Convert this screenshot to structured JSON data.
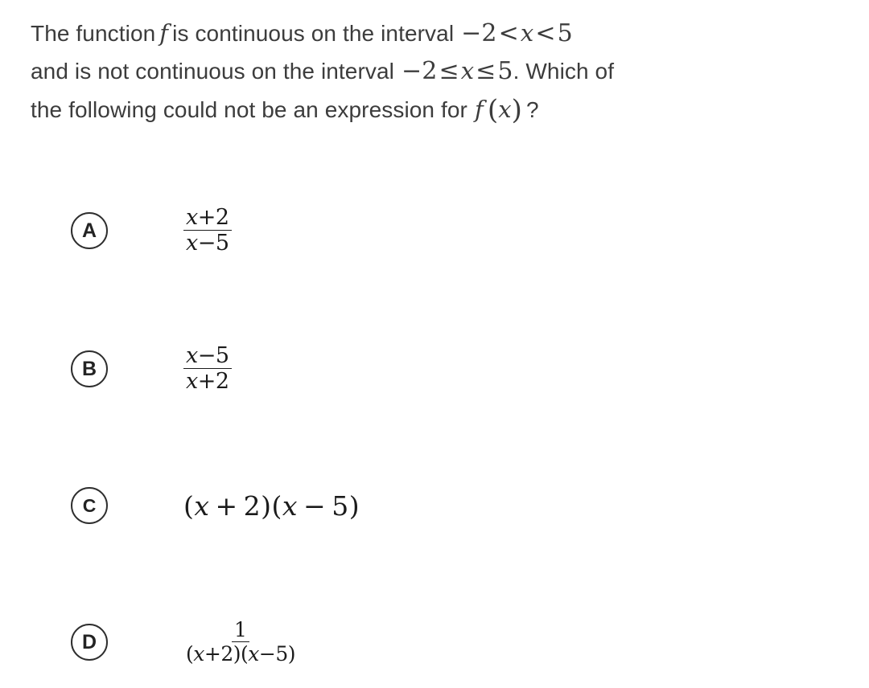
{
  "theme": {
    "background": "#ffffff",
    "text_color": "#3c3c3c",
    "math_color": "#1b1b1b",
    "bubble_border_color": "#2e2e2e"
  },
  "question": {
    "line1": {
      "text_a": "The function",
      "var_f": "f",
      "text_b": "is continuous on the interval",
      "math": {
        "lower": "−2",
        "rel1": "<",
        "var": "x",
        "rel2": "<",
        "upper": "5"
      }
    },
    "line2": {
      "text_a": "and is not continuous on the interval",
      "math": {
        "lower": "−2",
        "rel1": "≤",
        "var": "x",
        "rel2": "≤",
        "upper": "5"
      },
      "text_b": ". Which of"
    },
    "line3": {
      "text_a": "the following could not be an expression for",
      "func": {
        "name": "f",
        "open": "(",
        "arg": "x",
        "close": ")"
      },
      "text_b": "?"
    }
  },
  "options": [
    {
      "label": "A",
      "kind": "fraction",
      "numerator": {
        "var1": "x",
        "op": "+",
        "num1": "2"
      },
      "denominator": {
        "var1": "x",
        "op": "−",
        "num1": "5"
      },
      "plain": "(x+2)/(x-5)"
    },
    {
      "label": "B",
      "kind": "fraction",
      "numerator": {
        "var1": "x",
        "op": "−",
        "num1": "5"
      },
      "denominator": {
        "var1": "x",
        "op": "+",
        "num1": "2"
      },
      "plain": "(x-5)/(x+2)"
    },
    {
      "label": "C",
      "kind": "product",
      "factor1": {
        "open": "(",
        "var": "x",
        "op": "+",
        "num": "2",
        "close": ")"
      },
      "factor2": {
        "open": "(",
        "var": "x",
        "op": "−",
        "num": "5",
        "close": ")"
      },
      "plain": "(x + 2)(x - 5)"
    },
    {
      "label": "D",
      "kind": "fraction",
      "numerator_simple": "1",
      "denominator_product": {
        "f1_open": "(",
        "f1_var": "x",
        "f1_op": "+",
        "f1_num": "2",
        "f1_close": ")",
        "f2_open": "(",
        "f2_var": "x",
        "f2_op": "−",
        "f2_num": "5",
        "f2_close": ")"
      },
      "plain": "1/((x+2)(x-5))"
    }
  ]
}
